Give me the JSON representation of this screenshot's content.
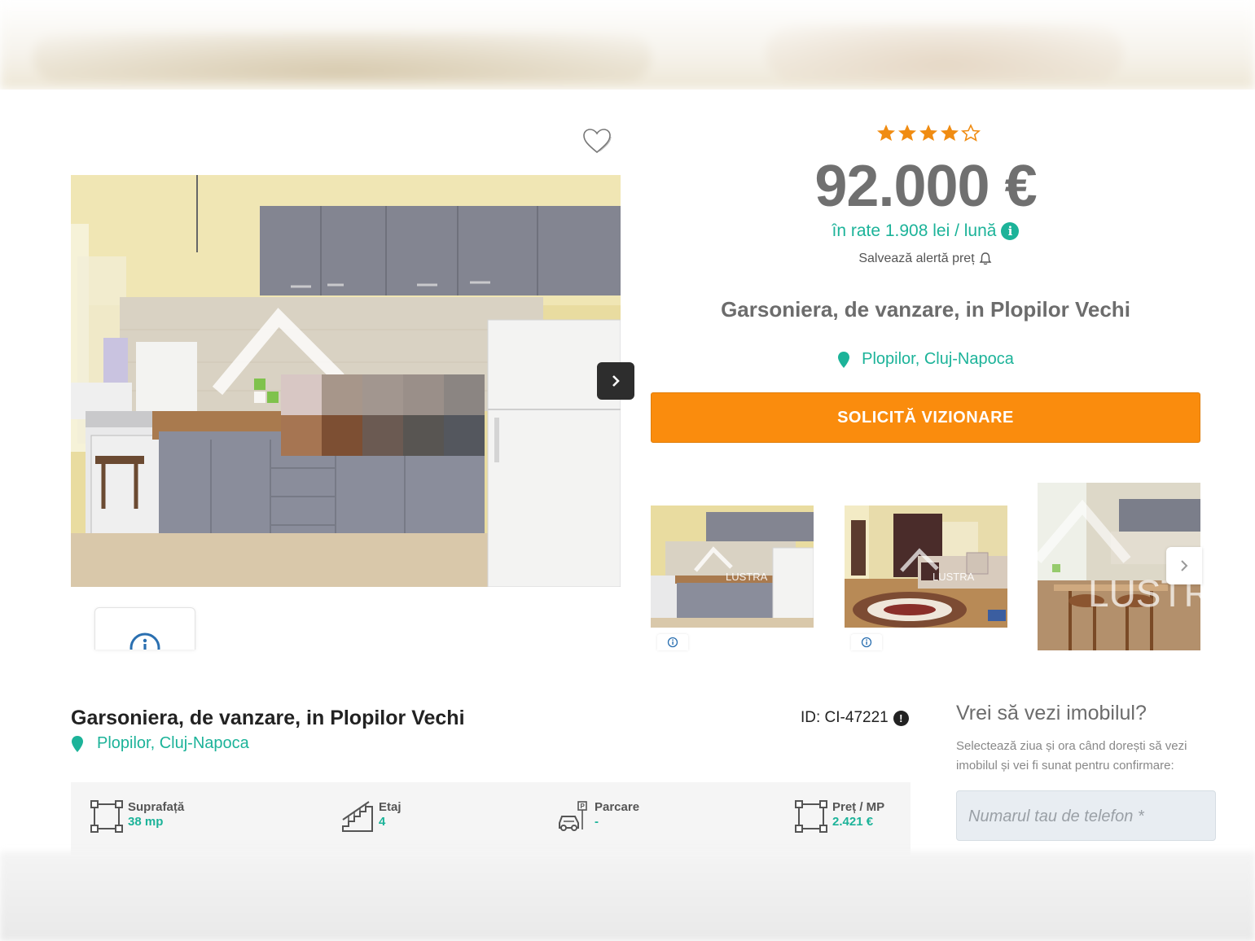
{
  "listing": {
    "rating": 4,
    "rating_max": 5,
    "price": "92.000 €",
    "installment": "în rate 1.908 lei / lună",
    "price_alert": "Salvează alertă preț",
    "title": "Garsoniera, de vanzare, in Plopilor Vechi",
    "location": "Plopilor, Cluj-Napoca",
    "cta": "SOLICITĂ VIZIONARE",
    "id": "ID: CI-47221"
  },
  "gallery": {
    "watermark": "LUSTRA",
    "thumb3_watermark": "LUSTR"
  },
  "features": [
    {
      "label": "Suprafață",
      "value": "38 mp",
      "icon": "area-icon"
    },
    {
      "label": "Etaj",
      "value": "4",
      "icon": "stairs-icon"
    },
    {
      "label": "Parcare",
      "value": "-",
      "icon": "parking-icon"
    },
    {
      "label": "Preț / MP",
      "value": "2.421 €",
      "icon": "area-icon"
    }
  ],
  "contact": {
    "title": "Vrei să vezi imobilul?",
    "description": "Selectează ziua și ora când dorești să vezi imobilul și vei fi sunat pentru confirmare:",
    "phone_placeholder": "Numarul tau de telefon *"
  },
  "colors": {
    "accent": "#1cb399",
    "cta": "#fa8c0d",
    "star": "#f08c12",
    "price": "#707070"
  }
}
